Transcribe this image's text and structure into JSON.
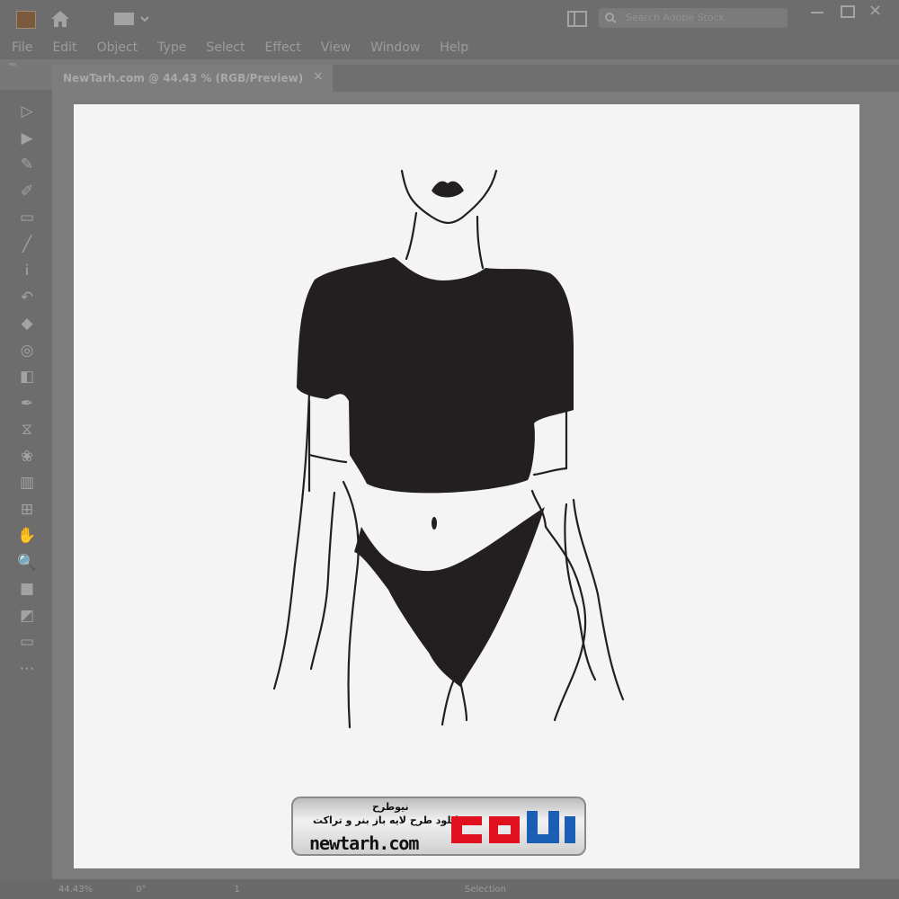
{
  "window": {
    "search_placeholder": "Search Adobe Stock",
    "menu": [
      "File",
      "Edit",
      "Object",
      "Type",
      "Select",
      "Effect",
      "View",
      "Window",
      "Help"
    ]
  },
  "document": {
    "tab_title": "NewTarh.com @ 44.43 % (RGB/Preview)",
    "close_glyph": "×"
  },
  "tools": [
    "selection-icon",
    "direct-selection-icon",
    "pen-icon",
    "curvature-icon",
    "rectangle-icon",
    "paintbrush-icon",
    "type-icon",
    "rotate-icon",
    "eraser-icon",
    "shape-builder-icon",
    "gradient-icon",
    "eyedropper-icon",
    "blend-icon",
    "symbol-sprayer-icon",
    "graph-icon",
    "artboard-icon",
    "hand-icon",
    "zoom-icon",
    "fill-stroke-icon",
    "drawing-modes-icon",
    "screen-mode-icon",
    "edit-toolbar-icon"
  ],
  "statusbar": {
    "zoom": "44.43%",
    "angle": "0°",
    "page": "1",
    "mode": "Selection"
  },
  "watermark": {
    "name": "نیوطرح",
    "tagline": "دانلود طرح لایه باز بنر و تراکت",
    "url": "newtarh.com",
    "logo": "نیوطرح"
  },
  "colors": {
    "artwork": "#231f20",
    "logo_red": "#e0101e"
  }
}
